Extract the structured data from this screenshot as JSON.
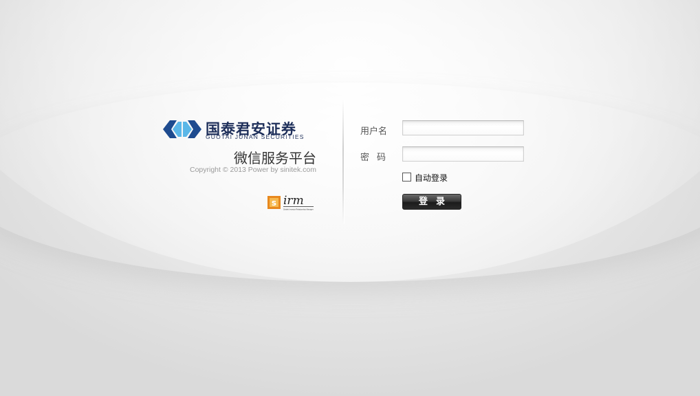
{
  "branding": {
    "company_cn": "国泰君安证券",
    "company_en": "GUOTAI JUNAN SECURITIES",
    "platform_title": "微信服务平台",
    "copyright": "Copyright © 2013 Power by sinitek.com",
    "partner_logo_text": "irm",
    "partner_logo_sub": "Sinitek Investor Relationship Manager",
    "brand_color": "#1e4b8f",
    "brand_light_color": "#5bb7e8",
    "partner_color": "#e8881e"
  },
  "form": {
    "username_label": "用户名",
    "username_value": "",
    "password_label": "密码",
    "password_value": "",
    "auto_login_label": "自动登录",
    "auto_login_checked": false,
    "login_button": "登录"
  }
}
